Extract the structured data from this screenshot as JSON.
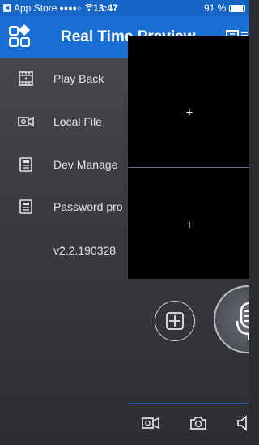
{
  "status_bar": {
    "back_app": "App Store",
    "signal": "●●●●○",
    "time": "13:47",
    "battery": "91 %",
    "battery_level": 0.91
  },
  "nav": {
    "title": "Real Time Preview",
    "menu_icon": "grid-menu-icon",
    "right_icon": "layout-icon"
  },
  "menu": {
    "items": [
      {
        "label": "Play Back",
        "icon": "film-icon"
      },
      {
        "label": "Local File",
        "icon": "video-camera-icon"
      },
      {
        "label": "Dev Manage",
        "icon": "device-icon"
      },
      {
        "label": "Password pro",
        "icon": "device-icon"
      }
    ],
    "version": "v2.2.190328"
  },
  "panes": [
    {
      "symbol": "+"
    },
    {
      "symbol": "+"
    }
  ],
  "controls": {
    "add_icon": "add-square-icon",
    "talk_icon": "microphone-icon",
    "bottom_icons": [
      "record-icon",
      "snapshot-icon",
      "speaker-icon"
    ]
  },
  "colors": {
    "nav_blue": "#1a6fd6",
    "status_blue": "#1565c7",
    "menu_bg": "#3a3c40",
    "video_bg": "#000000"
  }
}
